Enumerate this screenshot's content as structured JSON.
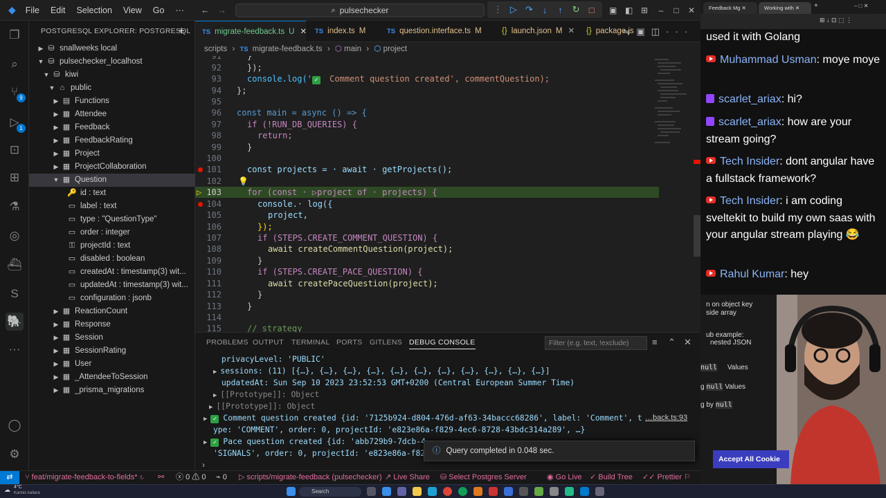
{
  "menu": [
    "File",
    "Edit",
    "Selection",
    "View",
    "Go"
  ],
  "command_center": "pulsechecker",
  "sidebar": {
    "title": "POSTGRESQL EXPLORER: POSTGRESQL",
    "items": [
      {
        "label": "snallweeks local"
      },
      {
        "label": "pulsechecker_localhost"
      },
      {
        "label": "kiwi"
      },
      {
        "label": "public"
      },
      {
        "label": "Functions"
      },
      {
        "label": "Attendee"
      },
      {
        "label": "Feedback"
      },
      {
        "label": "FeedbackRating"
      },
      {
        "label": "Project"
      },
      {
        "label": "ProjectCollaboration"
      },
      {
        "label": "Question"
      },
      {
        "label": "id : text"
      },
      {
        "label": "label : text"
      },
      {
        "label": "type : \"QuestionType\""
      },
      {
        "label": "order : integer"
      },
      {
        "label": "projectId : text"
      },
      {
        "label": "disabled : boolean"
      },
      {
        "label": "createdAt : timestamp(3) wit..."
      },
      {
        "label": "updatedAt : timestamp(3) wit..."
      },
      {
        "label": "configuration : jsonb"
      },
      {
        "label": "ReactionCount"
      },
      {
        "label": "Response"
      },
      {
        "label": "Session"
      },
      {
        "label": "SessionRating"
      },
      {
        "label": "User"
      },
      {
        "label": "_AttendeeToSession"
      },
      {
        "label": "_prisma_migrations"
      }
    ]
  },
  "tabs": [
    {
      "label": "migrate-feedback.ts",
      "mod": "U"
    },
    {
      "label": "index.ts",
      "mod": "M"
    },
    {
      "label": "question.interface.ts",
      "mod": "M"
    },
    {
      "label": "launch.json",
      "mod": "M"
    },
    {
      "label": "package.js",
      "mod": ""
    }
  ],
  "breadcrumb": {
    "folder": "scripts",
    "file": "migrate-feedback.ts",
    "fn": "main",
    "var": "project"
  },
  "line_numbers": [
    "91",
    "92",
    "93",
    "94",
    "95",
    "96",
    "97",
    "98",
    "99",
    "100",
    "101",
    "102",
    "103",
    "104",
    "105",
    "106",
    "107",
    "108",
    "109",
    "110",
    "111",
    "112",
    "113",
    "114",
    "115"
  ],
  "code": {
    "l92": "});",
    "l93a": "console.log('",
    "l93b": " Comment question created', commentQuestion);",
    "l94": "};",
    "l96": "const main = async () => {",
    "l97": "if (!RUN_DB_QUERIES) {",
    "l98": "return;",
    "l99": "}",
    "l101": "const projects = · await · getProjects();",
    "l103": "for (const · ▷project of · projects) {",
    "l104": "console.· log({",
    "l105": "project,",
    "l106": "});",
    "l107": "if (STEPS.CREATE_COMMENT_QUESTION) {",
    "l108": "await createCommentQuestion(project);",
    "l109": "}",
    "l110": "if (STEPS.CREATE_PACE_QUESTION) {",
    "l111": "await createPaceQuestion(project);",
    "l112": "}",
    "l113": "}",
    "l115": "// strategy"
  },
  "panel": {
    "tabs": [
      "PROBLEMS",
      "OUTPUT",
      "TERMINAL",
      "PORTS",
      "GITLENS",
      "DEBUG CONSOLE"
    ],
    "filter_placeholder": "Filter (e.g. text, !exclude)",
    "lines": [
      "privacyLevel: 'PUBLIC'",
      "sessions: (11) [{…}, {…}, {…}, {…}, {…}, {…}, {…}, {…}, {…}, {…}, {…}]",
      "updatedAt: Sun Sep 10 2023 23:52:53 GMT+0200 (Central European Summer Time)",
      "[[Prototype]]: Object",
      "[[Prototype]]: Object",
      "Comment question created {id: '7125b924-d804-476d-af63-34baccc68286', label: 'Comment', t",
      "ype: 'COMMENT', order: 0, projectId: 'e823e86a-f829-4ec6-8728-43bdc314a289', …}",
      "Pace question created {id: 'abb729b9-7dcb-4",
      "'SIGNALS', order: 0, projectId: 'e823e86a-f829"
    ],
    "source_link": "…back.ts:93",
    "toast": "Query completed in 0.048 sec."
  },
  "status": {
    "branch": "feat/migrate-feedback-to-fields*",
    "errors": "0",
    "warnings": "0",
    "ports": "0",
    "debug": "scripts/migrate-feedback (pulsechecker)",
    "live_share": "Live Share",
    "postgres": "Select Postgres Server",
    "go_live": "Go Live",
    "build_tree": "Build Tree",
    "prettier": "Prettier"
  },
  "taskbar": {
    "temp": "4°C",
    "weather": "Kannis kallara",
    "search": "Search"
  },
  "browser": {
    "tab1": "Feedback Mg",
    "tab2": "Working with"
  },
  "chat": [
    {
      "user": "",
      "text": "used it with Golang",
      "platform": "youtube"
    },
    {
      "user": "Muhammad Usman",
      "text": "moye moye",
      "platform": "youtube"
    },
    {
      "user": "scarlet_ariax",
      "text": "hi?",
      "platform": "twitch"
    },
    {
      "user": "scarlet_ariax",
      "text": "how are your stream going?",
      "platform": "twitch"
    },
    {
      "user": "Tech Insider",
      "text": "dont angular have a fullstack framework?",
      "platform": "youtube"
    },
    {
      "user": "Tech Insider",
      "text": "i am coding sveltekit to build my own saas with your angular stream playing 😂",
      "platform": "youtube"
    },
    {
      "user": "Rahul Kumar",
      "text": "hey",
      "platform": "youtube"
    }
  ],
  "lower_page": {
    "l1": "n on object key",
    "l2": "side array",
    "l3": "ub example:",
    "l4": "nested JSON",
    "l5": "Values",
    "l6": "Values",
    "l7": "g by",
    "null1": "null",
    "null2": "null",
    "null3": "null",
    "accept": "Accept All Cookie"
  },
  "colors": {
    "accent": "#0078d4",
    "highlight": "#2e4a24",
    "chat_user": "#8ab4f8"
  }
}
